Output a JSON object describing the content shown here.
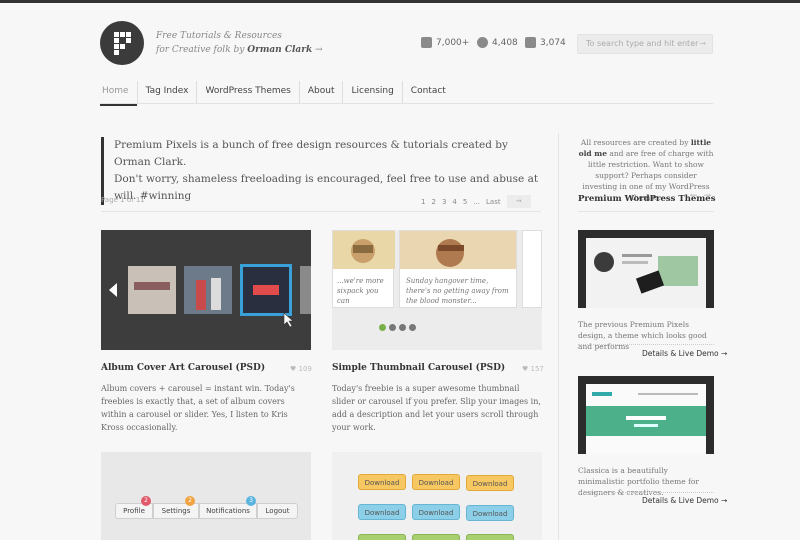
{
  "header": {
    "tagline_line1": "Free Tutorials & Resources",
    "tagline_line2_prefix": "for Creative folk by",
    "tagline_author": "Orman Clark",
    "tagline_arrow": "→",
    "stats": {
      "rss": "7,000+",
      "twitter": "4,408",
      "facebook": "3,074"
    },
    "search": {
      "placeholder": "To search type and hit enter",
      "arrow": "→"
    }
  },
  "nav": {
    "items": [
      "Home",
      "Tag Index",
      "WordPress Themes",
      "About",
      "Licensing",
      "Contact"
    ]
  },
  "intro": {
    "line1": "Premium Pixels is a bunch of free design resources & tutorials created by Orman Clark.",
    "line2": "Don't worry, shameless freeloading is encouraged, feel free to use and abuse at will. #winning"
  },
  "pagination": {
    "info": "Page 1 of 11",
    "pages": [
      "1",
      "2",
      "3",
      "4",
      "5",
      "...",
      "Last"
    ],
    "next": "→"
  },
  "posts": [
    {
      "title": "Album Cover Art Carousel (PSD)",
      "likes": "109",
      "desc": "Album covers + carousel = instant win. Today's freebies is exactly that, a set of album covers within a carousel or slider. Yes, I listen to Kris Kross occasionally."
    },
    {
      "title": "Simple Thumbnail Carousel (PSD)",
      "likes": "157",
      "desc": "Today's freebie is a super awesome thumbnail slider or carousel if you prefer. Slip your images in, add a description and let your users scroll through your work."
    }
  ],
  "thumb2": {
    "card1_text": "...we're more sixpack you can",
    "card2_text": "Sunday hangover time, there's no getting away from the blood monster..."
  },
  "thumb3": {
    "pills": [
      "Profile",
      "Settings",
      "Notifications",
      "Logout"
    ],
    "badges": [
      "2",
      "2",
      "3"
    ]
  },
  "thumb4": {
    "button_label": "Download"
  },
  "sidebar": {
    "note_prefix": "All resources are created by",
    "note_author": "little old me",
    "note_rest": "and are free of charge with little restriction. Want to show support? Perhaps consider investing in one of my WordPress themes.",
    "title": "Premium WordPress Themes",
    "prev": "←",
    "next": "→",
    "themes": [
      {
        "desc": "The previous Premium Pixels design, a theme which looks good and performs",
        "link": "Details & Live Demo →"
      },
      {
        "desc": "Classica is a beautifully minimalistic portfolio theme for designers & creatives.",
        "link": "Details & Live Demo →"
      }
    ]
  },
  "colors": {
    "accent": "#3b3b3b",
    "highlight": "#3aa0d8"
  }
}
